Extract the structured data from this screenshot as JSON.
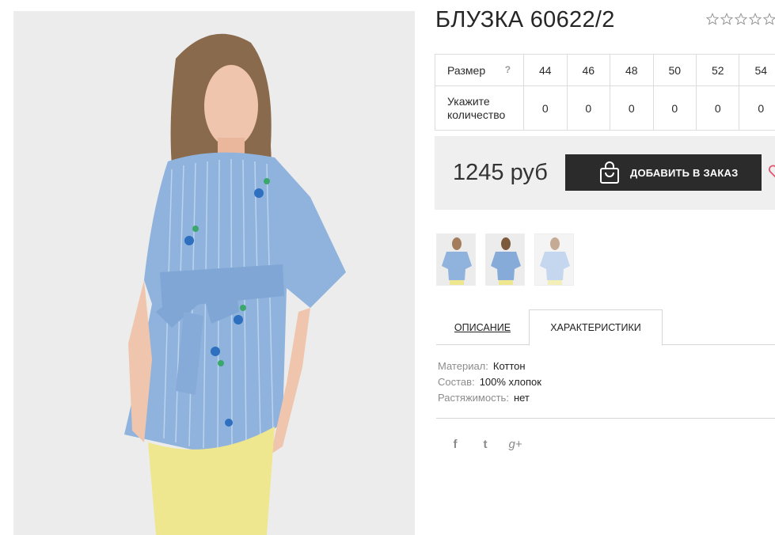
{
  "product": {
    "title": "БЛУЗКА 60622/2",
    "rating_stars": 5,
    "rating_filled": 0
  },
  "sizes": {
    "size_label": "Размер",
    "help_mark": "?",
    "qty_label": "Укажите количество",
    "values": [
      "44",
      "46",
      "48",
      "50",
      "52",
      "54"
    ],
    "quantities": [
      "0",
      "0",
      "0",
      "0",
      "0",
      "0"
    ]
  },
  "purchase": {
    "price": "1245 руб",
    "order_label": "ДОБАВИТЬ В ЗАКАЗ"
  },
  "tabs": {
    "description": "ОПИСАНИЕ",
    "characteristics": "ХАРАКТЕРИСТИКИ"
  },
  "characteristics": [
    {
      "key": "Материал:",
      "value": "Коттон"
    },
    {
      "key": "Состав:",
      "value": "100% хлопок"
    },
    {
      "key": "Растяжимость:",
      "value": "нет"
    }
  ],
  "social": {
    "facebook": "f",
    "twitter": "t",
    "google": "g+"
  },
  "icons": {
    "rating": "star-outline-icon",
    "order": "shopping-bag-icon",
    "wishlist": "heart-icon"
  },
  "colors": {
    "accent_dark": "#2b2b2b",
    "price_bg": "#efefef",
    "heart": "#e0566f",
    "blouse": "#8fb3dd",
    "pants": "#eee78f"
  }
}
